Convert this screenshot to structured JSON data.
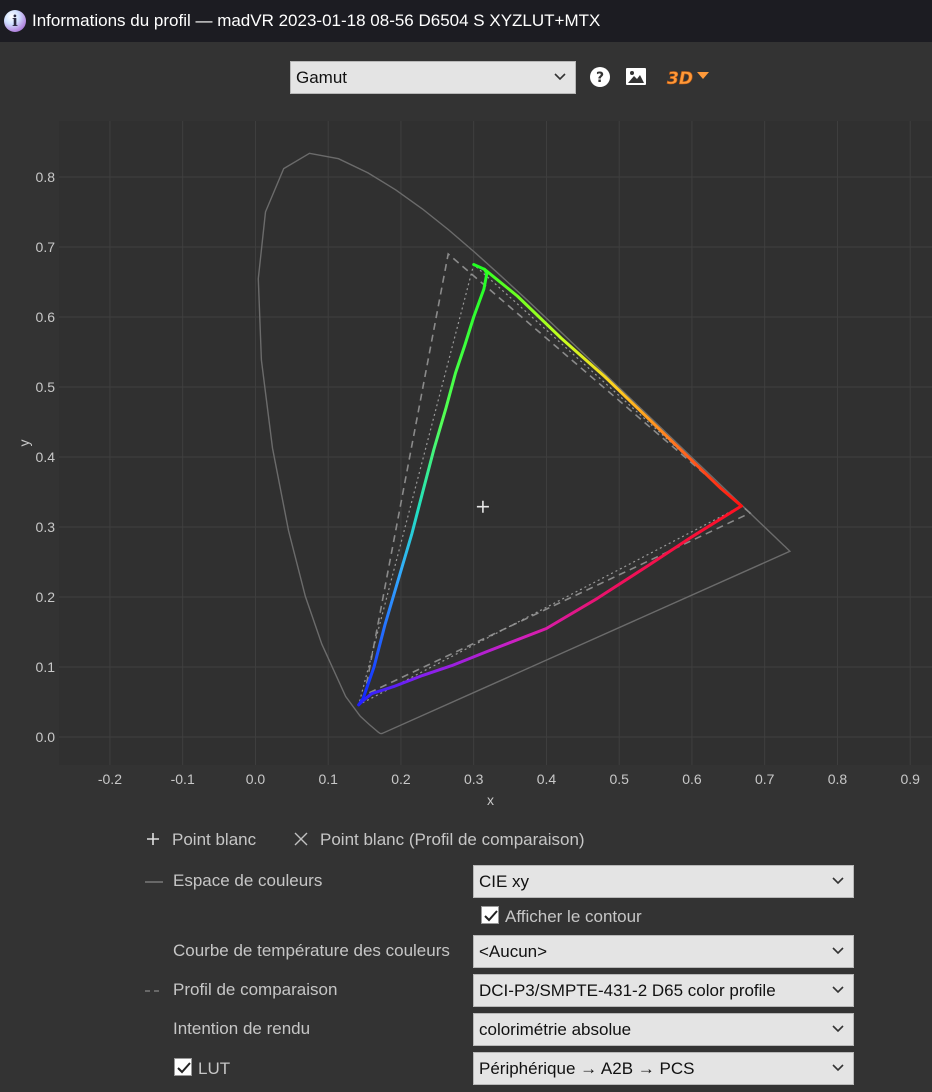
{
  "window": {
    "title": "Informations du profil — madVR 2023-01-18 08-56 D6504 S XYZLUT+MTX",
    "icon": "info-icon"
  },
  "toolbar": {
    "view_select": "Gamut",
    "help_icon": "question-circle-icon",
    "image_icon": "image-icon",
    "three_d_label": "3D"
  },
  "chart_data": {
    "type": "scatter",
    "xlabel": "x",
    "ylabel": "y",
    "xlim": [
      -0.27,
      0.93
    ],
    "ylim": [
      -0.04,
      0.88
    ],
    "grid": true,
    "x_ticks": [
      "-0.2",
      "-0.1",
      "0.0",
      "0.1",
      "0.2",
      "0.3",
      "0.4",
      "0.5",
      "0.6",
      "0.7",
      "0.8",
      "0.9"
    ],
    "y_ticks": [
      "0.0",
      "0.1",
      "0.2",
      "0.3",
      "0.4",
      "0.5",
      "0.6",
      "0.7",
      "0.8"
    ],
    "spectral_locus": [
      [
        0.1741,
        0.005
      ],
      [
        0.1733,
        0.0048
      ],
      [
        0.1726,
        0.0048
      ],
      [
        0.1714,
        0.0051
      ],
      [
        0.1689,
        0.0069
      ],
      [
        0.1644,
        0.0109
      ],
      [
        0.1566,
        0.0177
      ],
      [
        0.144,
        0.0297
      ],
      [
        0.1241,
        0.0578
      ],
      [
        0.0913,
        0.1327
      ],
      [
        0.0687,
        0.2007
      ],
      [
        0.0454,
        0.295
      ],
      [
        0.0235,
        0.4127
      ],
      [
        0.0082,
        0.5384
      ],
      [
        0.0039,
        0.6548
      ],
      [
        0.0139,
        0.7502
      ],
      [
        0.0389,
        0.812
      ],
      [
        0.0743,
        0.8338
      ],
      [
        0.1142,
        0.8262
      ],
      [
        0.1547,
        0.8059
      ],
      [
        0.1929,
        0.7816
      ],
      [
        0.2296,
        0.7543
      ],
      [
        0.2658,
        0.7243
      ],
      [
        0.3016,
        0.6923
      ],
      [
        0.3373,
        0.6589
      ],
      [
        0.3731,
        0.6245
      ],
      [
        0.4087,
        0.5896
      ],
      [
        0.4441,
        0.5547
      ],
      [
        0.4788,
        0.5202
      ],
      [
        0.5125,
        0.4866
      ],
      [
        0.5448,
        0.4544
      ],
      [
        0.5752,
        0.4242
      ],
      [
        0.6029,
        0.3965
      ],
      [
        0.627,
        0.3725
      ],
      [
        0.6482,
        0.3514
      ],
      [
        0.6658,
        0.334
      ],
      [
        0.6801,
        0.3197
      ],
      [
        0.6915,
        0.3083
      ],
      [
        0.7006,
        0.2993
      ],
      [
        0.7079,
        0.292
      ],
      [
        0.714,
        0.2859
      ],
      [
        0.719,
        0.2809
      ],
      [
        0.723,
        0.277
      ],
      [
        0.726,
        0.274
      ],
      [
        0.7283,
        0.2717
      ],
      [
        0.73,
        0.27
      ],
      [
        0.7347,
        0.2653
      ]
    ],
    "comparison_gamut": {
      "name": "DCI-P3/SMPTE-431-2 D65 color profile",
      "red": [
        0.68,
        0.32
      ],
      "green": [
        0.265,
        0.69
      ],
      "blue": [
        0.15,
        0.06
      ]
    },
    "profile_gamut": {
      "red": [
        0.668,
        0.33
      ],
      "green": [
        0.3,
        0.675
      ],
      "blue": [
        0.142,
        0.046
      ]
    },
    "green_curve": [
      [
        0.3,
        0.675
      ],
      [
        0.315,
        0.668
      ],
      [
        0.318,
        0.662
      ],
      [
        0.314,
        0.64
      ],
      [
        0.3,
        0.6
      ],
      [
        0.288,
        0.56
      ],
      [
        0.275,
        0.52
      ],
      [
        0.262,
        0.47
      ],
      [
        0.245,
        0.41
      ],
      [
        0.23,
        0.35
      ],
      [
        0.215,
        0.29
      ],
      [
        0.195,
        0.22
      ],
      [
        0.178,
        0.16
      ],
      [
        0.163,
        0.1
      ],
      [
        0.148,
        0.055
      ],
      [
        0.142,
        0.046
      ]
    ],
    "red_blue_curve": [
      [
        0.668,
        0.33
      ],
      [
        0.6,
        0.286
      ],
      [
        0.54,
        0.245
      ],
      [
        0.47,
        0.198
      ],
      [
        0.4,
        0.155
      ],
      [
        0.318,
        0.122
      ],
      [
        0.27,
        0.102
      ],
      [
        0.23,
        0.088
      ],
      [
        0.19,
        0.072
      ],
      [
        0.16,
        0.062
      ],
      [
        0.148,
        0.052
      ],
      [
        0.142,
        0.046
      ]
    ],
    "red_green_curve": [
      [
        0.315,
        0.668
      ],
      [
        0.36,
        0.63
      ],
      [
        0.42,
        0.57
      ],
      [
        0.48,
        0.515
      ],
      [
        0.54,
        0.455
      ],
      [
        0.6,
        0.395
      ],
      [
        0.64,
        0.355
      ],
      [
        0.668,
        0.33
      ]
    ],
    "white_point": [
      0.3127,
      0.329
    ]
  },
  "legend": {
    "white_point": "Point blanc",
    "white_point_compare": "Point blanc (Profil de comparaison)"
  },
  "settings": {
    "color_space_label": "Espace de couleurs",
    "color_space_value": "CIE xy",
    "show_outline_label": "Afficher le contour",
    "show_outline_checked": true,
    "temperature_curve_label": "Courbe de température des couleurs",
    "temperature_curve_value": "<Aucun>",
    "comparison_profile_label": "Profil de comparaison",
    "comparison_profile_value": "DCI-P3/SMPTE-431-2 D65 color profile",
    "rendering_intent_label": "Intention de rendu",
    "rendering_intent_value": "colorimétrie absolue",
    "lut_label": "LUT",
    "lut_checked": true,
    "lut_value": "Périphérique → A2B → PCS"
  }
}
